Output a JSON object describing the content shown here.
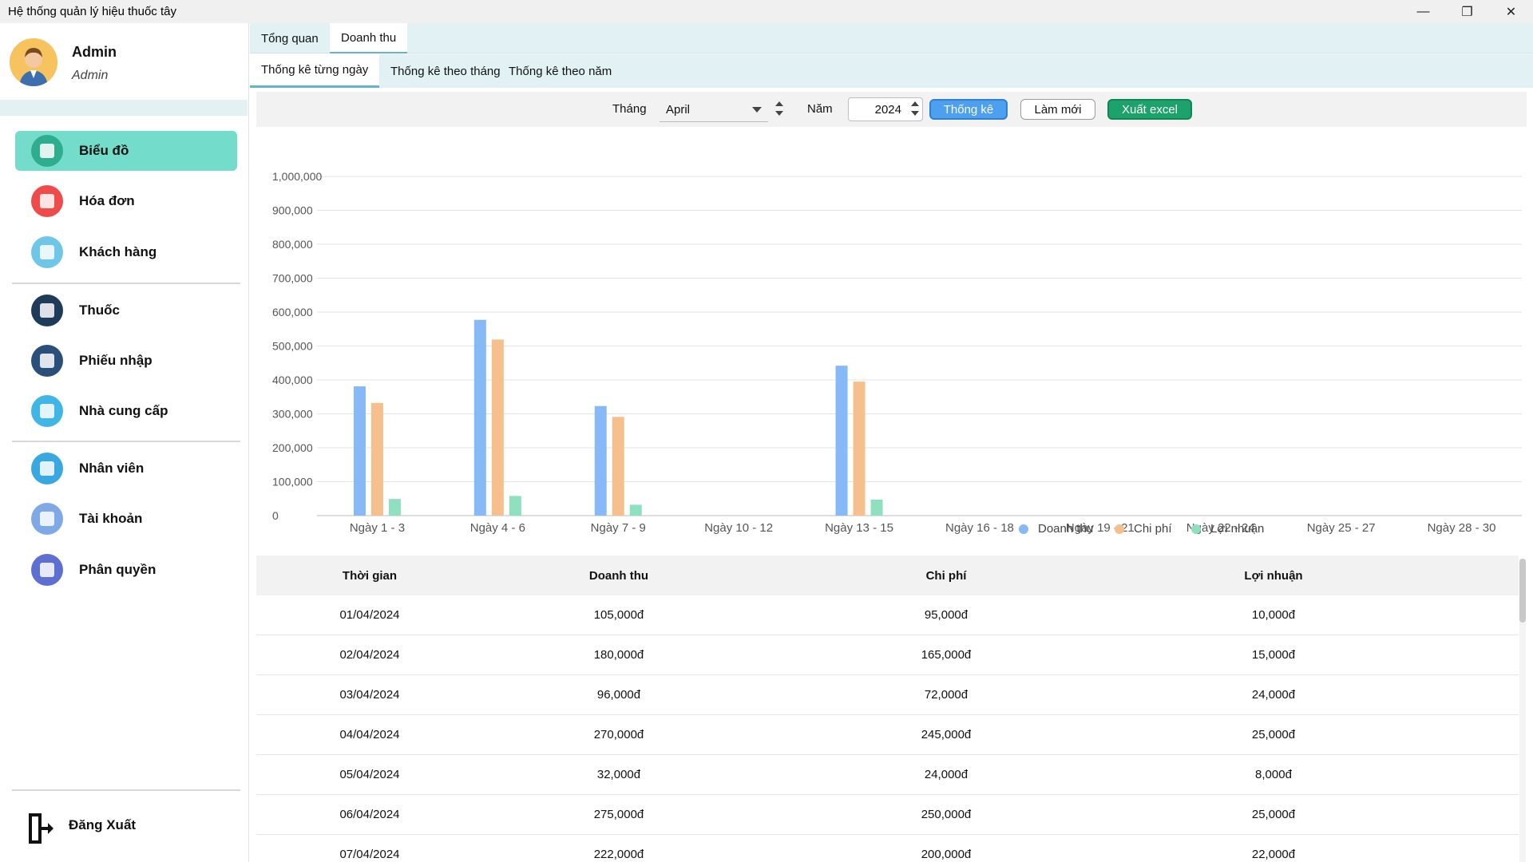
{
  "window": {
    "title": "Hệ thống quản lý hiệu thuốc tây",
    "minimize_icon": "minimize-icon",
    "restore_icon": "restore-icon",
    "close_icon": "close-icon"
  },
  "sidebar": {
    "user": {
      "name": "Admin",
      "role": "Admin"
    },
    "items": [
      {
        "label": "Biểu đồ",
        "icon": "chart-icon",
        "active": true,
        "color": "#2fae8f"
      },
      {
        "label": "Hóa đơn",
        "icon": "invoice-icon",
        "active": false,
        "color": "#f04b4b"
      },
      {
        "label": "Khách hàng",
        "icon": "customers-icon",
        "active": false,
        "color": "#6ec6e8"
      },
      {
        "label": "Thuốc",
        "icon": "pill-icon",
        "active": false,
        "color": "#1f3b5a"
      },
      {
        "label": "Phiếu nhập",
        "icon": "import-receipt-icon",
        "active": false,
        "color": "#2a4f7a"
      },
      {
        "label": "Nhà cung cấp",
        "icon": "supplier-icon",
        "active": false,
        "color": "#3fb6e6"
      },
      {
        "label": "Nhân viên",
        "icon": "employee-icon",
        "active": false,
        "color": "#3aa8e0"
      },
      {
        "label": "Tài khoản",
        "icon": "account-icon",
        "active": false,
        "color": "#7fa8e6"
      },
      {
        "label": "Phân quyền",
        "icon": "permission-lock-icon",
        "active": false,
        "color": "#5d6fd1"
      }
    ],
    "logout": {
      "label": "Đăng Xuất",
      "icon": "logout-icon"
    }
  },
  "tabs": {
    "top": [
      "Tổng quan",
      "Doanh thu"
    ],
    "top_active": 1,
    "sub": [
      "Thống kê từng ngày",
      "Thống kê theo tháng",
      "Thống kê theo năm"
    ],
    "sub_active": 0
  },
  "filters": {
    "month_label": "Tháng",
    "month_value": "April",
    "year_label": "Năm",
    "year_value": "2024",
    "btn_stats": "Thống kê",
    "btn_refresh": "Làm mới",
    "btn_export": "Xuất excel"
  },
  "chart_data": {
    "type": "bar",
    "categories": [
      "Ngày 1 - 3",
      "Ngày 4 - 6",
      "Ngày 7 - 9",
      "Ngày 10 - 12",
      "Ngày 13 - 15",
      "Ngày 16 - 18",
      "Ngày 19 - 21",
      "Ngày 22 - 24",
      "Ngày 25 - 27",
      "Ngày 28 - 30"
    ],
    "series": [
      {
        "name": "Doanh thu",
        "color": "#86b9f5",
        "values": [
          381000,
          577000,
          323000,
          0,
          442000,
          0,
          0,
          0,
          0,
          0
        ]
      },
      {
        "name": "Chi phí",
        "color": "#f6c08e",
        "values": [
          332000,
          519000,
          291000,
          0,
          395000,
          0,
          0,
          0,
          0,
          0
        ]
      },
      {
        "name": "Lợi nhuận",
        "color": "#8ee0bf",
        "values": [
          49000,
          58000,
          32000,
          0,
          47000,
          0,
          0,
          0,
          0,
          0
        ]
      }
    ],
    "y_ticks": [
      "1,000,000",
      "900,000",
      "800,000",
      "700,000",
      "600,000",
      "500,000",
      "400,000",
      "300,000",
      "200,000",
      "100,000",
      "0"
    ],
    "ylim": [
      0,
      1000000
    ],
    "grid": true,
    "legend_position": "bottom"
  },
  "table": {
    "headers": [
      "Thời gian",
      "Doanh thu",
      "Chi phí",
      "Lợi nhuận"
    ],
    "rows": [
      [
        "01/04/2024",
        "105,000đ",
        "95,000đ",
        "10,000đ"
      ],
      [
        "02/04/2024",
        "180,000đ",
        "165,000đ",
        "15,000đ"
      ],
      [
        "03/04/2024",
        "96,000đ",
        "72,000đ",
        "24,000đ"
      ],
      [
        "04/04/2024",
        "270,000đ",
        "245,000đ",
        "25,000đ"
      ],
      [
        "05/04/2024",
        "32,000đ",
        "24,000đ",
        "8,000đ"
      ],
      [
        "06/04/2024",
        "275,000đ",
        "250,000đ",
        "25,000đ"
      ],
      [
        "07/04/2024",
        "222,000đ",
        "200,000đ",
        "22,000đ"
      ]
    ]
  }
}
